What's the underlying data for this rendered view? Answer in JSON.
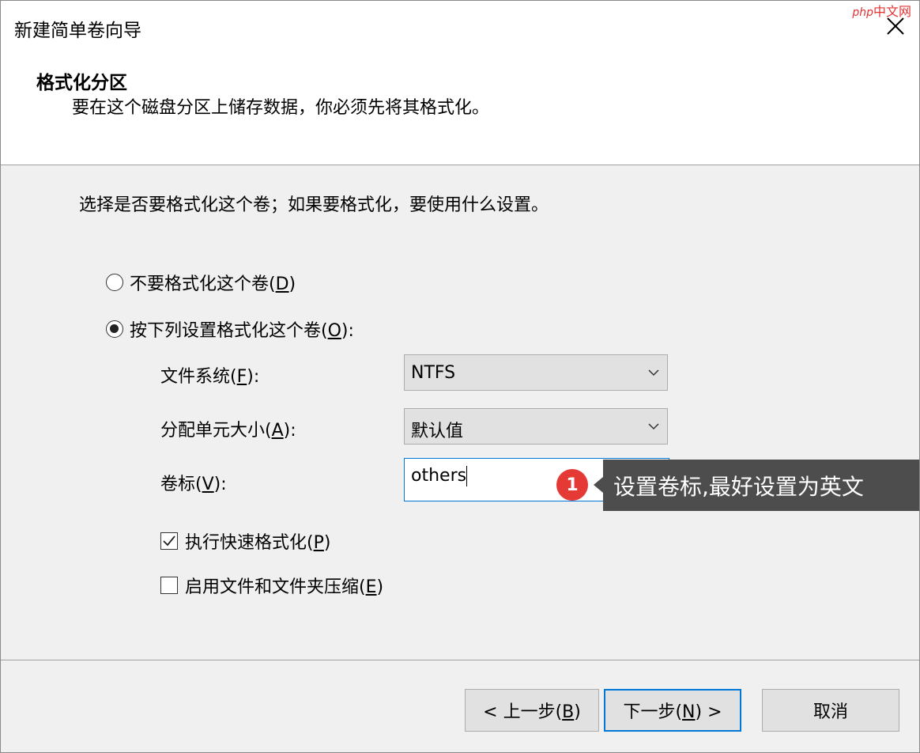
{
  "window": {
    "title": "新建简单卷向导"
  },
  "watermark": {
    "prefix": "php",
    "text": "中文网"
  },
  "header": {
    "title": "格式化分区",
    "subtitle": "要在这个磁盘分区上储存数据，你必须先将其格式化。"
  },
  "instruction": "选择是否要格式化这个卷；如果要格式化，要使用什么设置。",
  "options": {
    "no_format": {
      "label": "不要格式化这个卷(",
      "key": "D",
      "suffix": ")",
      "checked": false
    },
    "format": {
      "label": "按下列设置格式化这个卷(",
      "key": "O",
      "suffix": "):",
      "checked": true
    }
  },
  "fields": {
    "file_system": {
      "label": "文件系统(",
      "key": "F",
      "suffix": "):",
      "value": "NTFS"
    },
    "alloc_unit": {
      "label": "分配单元大小(",
      "key": "A",
      "suffix": "):",
      "value": "默认值"
    },
    "volume_label": {
      "label": "卷标(",
      "key": "V",
      "suffix": "):",
      "value": "others"
    }
  },
  "checks": {
    "quick_format": {
      "label": "执行快速格式化(",
      "key": "P",
      "suffix": ")",
      "checked": true
    },
    "compression": {
      "label": "启用文件和文件夹压缩(",
      "key": "E",
      "suffix": ")",
      "checked": false
    }
  },
  "buttons": {
    "back": {
      "prefix": "< 上一步(",
      "key": "B",
      "suffix": ")"
    },
    "next": {
      "prefix": "下一步(",
      "key": "N",
      "suffix": ") >"
    },
    "cancel": {
      "label": "取消"
    }
  },
  "annotation": {
    "number": "1",
    "text": "设置卷标,最好设置为英文"
  },
  "colors": {
    "accent": "#0078d7",
    "tooltip_bg": "#4d4d4d",
    "marker": "#e53935",
    "dialog_bg": "#f0f0f0"
  }
}
